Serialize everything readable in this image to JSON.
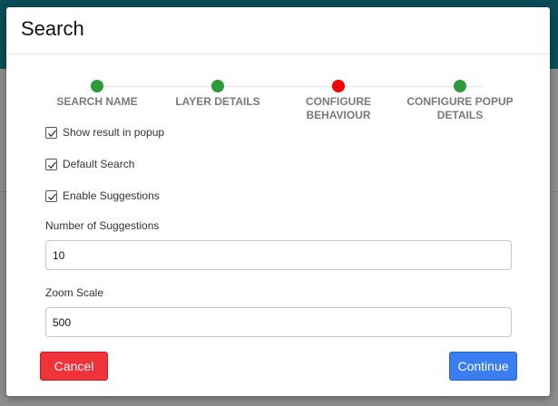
{
  "modal": {
    "title": "Search"
  },
  "stepper": {
    "steps": [
      {
        "label": "SEARCH NAME",
        "status_color": "#2e9b3a"
      },
      {
        "label": "LAYER DETAILS",
        "status_color": "#2e9b3a"
      },
      {
        "label": "CONFIGURE BEHAVIOUR",
        "status_color": "#f00000"
      },
      {
        "label": "CONFIGURE POPUP DETAILS",
        "status_color": "#2e9b3a"
      }
    ]
  },
  "options": [
    {
      "label": "Show result in popup",
      "checked": true
    },
    {
      "label": "Default Search",
      "checked": true
    },
    {
      "label": "Enable Suggestions",
      "checked": true
    }
  ],
  "fields": {
    "suggestions": {
      "label": "Number of Suggestions",
      "value": "10"
    },
    "zoom_scale": {
      "label": "Zoom Scale",
      "value": "500"
    }
  },
  "buttons": {
    "cancel_label": "Cancel",
    "continue_label": "Continue"
  },
  "colors": {
    "cancel": "#f0333a",
    "continue": "#3a7df0"
  }
}
